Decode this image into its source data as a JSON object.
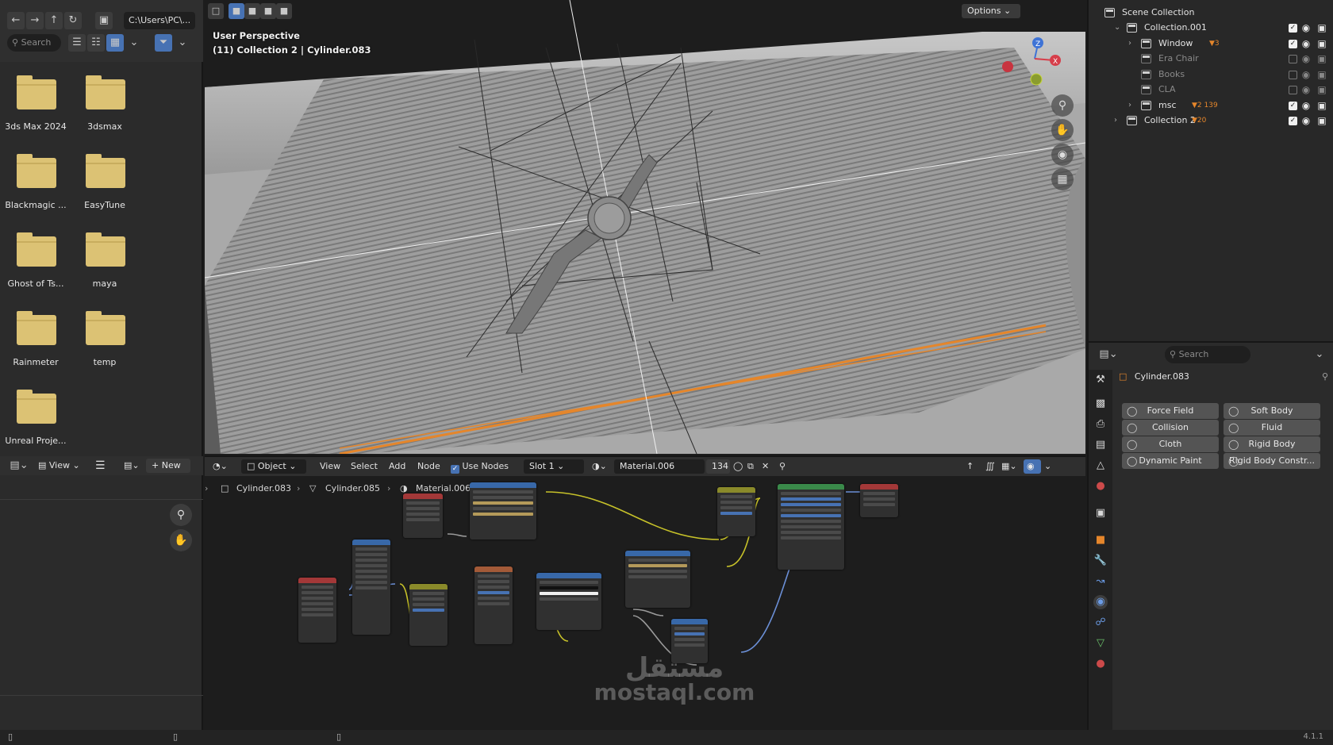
{
  "file_browser": {
    "nav_icons": [
      "arrow-left-icon",
      "arrow-right-icon",
      "arrow-up-icon",
      "refresh-icon",
      "new-folder-icon"
    ],
    "path": "C:\\Users\\PC\\...",
    "search_placeholder": "Search",
    "folders": [
      "3ds Max 2024",
      "3dsmax",
      "Blackmagic ...",
      "EasyTune",
      "Ghost of Ts...",
      "maya",
      "Rainmeter",
      "temp",
      "Unreal Proje..."
    ]
  },
  "viewport": {
    "options_label": "Options",
    "perspective_label": "User Perspective",
    "context_label": "(11) Collection 2 | Cylinder.083",
    "gizmo_axes": [
      "Z",
      "X"
    ]
  },
  "outliner": {
    "root": "Scene Collection",
    "rows": [
      {
        "label": "Collection.001",
        "level": 1,
        "checked": true,
        "dim": false,
        "badge": ""
      },
      {
        "label": "Window",
        "level": 2,
        "checked": true,
        "dim": false,
        "badge": "3"
      },
      {
        "label": "Era Chair",
        "level": 2,
        "checked": false,
        "dim": true,
        "badge": ""
      },
      {
        "label": "Books",
        "level": 2,
        "checked": false,
        "dim": true,
        "badge": ""
      },
      {
        "label": "CLA",
        "level": 2,
        "checked": false,
        "dim": true,
        "badge": ""
      },
      {
        "label": "msc",
        "level": 2,
        "checked": true,
        "dim": false,
        "badge": "2 139"
      },
      {
        "label": "Collection 2",
        "level": 1,
        "checked": true,
        "dim": false,
        "badge": "20"
      }
    ]
  },
  "properties": {
    "search_placeholder": "Search",
    "object_name": "Cylinder.083",
    "physics_buttons": [
      {
        "label": "Force Field",
        "icon": "force-field-icon"
      },
      {
        "label": "Soft Body",
        "icon": "soft-body-icon"
      },
      {
        "label": "Collision",
        "icon": "collision-icon"
      },
      {
        "label": "Fluid",
        "icon": "fluid-icon"
      },
      {
        "label": "Cloth",
        "icon": "cloth-icon"
      },
      {
        "label": "Rigid Body",
        "icon": "rigid-body-icon"
      },
      {
        "label": "Dynamic Paint",
        "icon": "dynamic-paint-icon"
      },
      {
        "label": "Rigid Body Constr...",
        "icon": "rigid-body-constraint-icon"
      }
    ]
  },
  "image_editor": {
    "view_label": "View",
    "new_label": "New"
  },
  "node_editor": {
    "mode": "Object",
    "menus": [
      "View",
      "Select",
      "Add",
      "Node"
    ],
    "use_nodes_label": "Use Nodes",
    "use_nodes_checked": true,
    "slot": "Slot 1",
    "material": "Material.006",
    "users": "134",
    "breadcrumb": [
      "Cylinder.083",
      "Cylinder.085",
      "Material.006"
    ]
  },
  "statusbar": {
    "version": "4.1.1"
  },
  "watermark": {
    "line1": "مستقل",
    "line2": "mostaql.com"
  },
  "colors": {
    "accent_blue": "#4772b3",
    "selection_orange": "#e5862b",
    "folder_yellow": "#dcc274",
    "panel_bg": "#2b2b2b",
    "node_link_yellow": "#c7c229",
    "node_link_blue": "#6b8fd6"
  }
}
